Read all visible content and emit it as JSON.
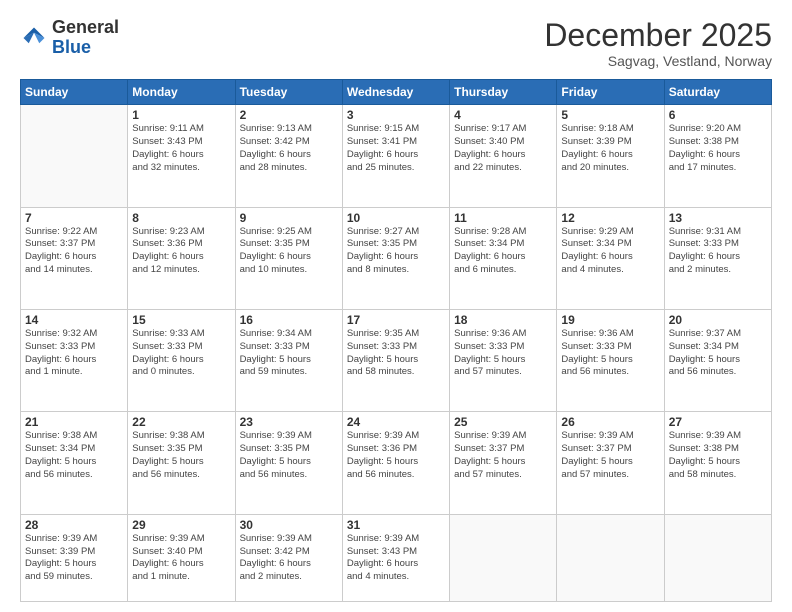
{
  "header": {
    "logo_general": "General",
    "logo_blue": "Blue",
    "month_title": "December 2025",
    "subtitle": "Sagvag, Vestland, Norway"
  },
  "calendar": {
    "days_of_week": [
      "Sunday",
      "Monday",
      "Tuesday",
      "Wednesday",
      "Thursday",
      "Friday",
      "Saturday"
    ],
    "weeks": [
      [
        {
          "day": "",
          "info": ""
        },
        {
          "day": "1",
          "info": "Sunrise: 9:11 AM\nSunset: 3:43 PM\nDaylight: 6 hours\nand 32 minutes."
        },
        {
          "day": "2",
          "info": "Sunrise: 9:13 AM\nSunset: 3:42 PM\nDaylight: 6 hours\nand 28 minutes."
        },
        {
          "day": "3",
          "info": "Sunrise: 9:15 AM\nSunset: 3:41 PM\nDaylight: 6 hours\nand 25 minutes."
        },
        {
          "day": "4",
          "info": "Sunrise: 9:17 AM\nSunset: 3:40 PM\nDaylight: 6 hours\nand 22 minutes."
        },
        {
          "day": "5",
          "info": "Sunrise: 9:18 AM\nSunset: 3:39 PM\nDaylight: 6 hours\nand 20 minutes."
        },
        {
          "day": "6",
          "info": "Sunrise: 9:20 AM\nSunset: 3:38 PM\nDaylight: 6 hours\nand 17 minutes."
        }
      ],
      [
        {
          "day": "7",
          "info": "Sunrise: 9:22 AM\nSunset: 3:37 PM\nDaylight: 6 hours\nand 14 minutes."
        },
        {
          "day": "8",
          "info": "Sunrise: 9:23 AM\nSunset: 3:36 PM\nDaylight: 6 hours\nand 12 minutes."
        },
        {
          "day": "9",
          "info": "Sunrise: 9:25 AM\nSunset: 3:35 PM\nDaylight: 6 hours\nand 10 minutes."
        },
        {
          "day": "10",
          "info": "Sunrise: 9:27 AM\nSunset: 3:35 PM\nDaylight: 6 hours\nand 8 minutes."
        },
        {
          "day": "11",
          "info": "Sunrise: 9:28 AM\nSunset: 3:34 PM\nDaylight: 6 hours\nand 6 minutes."
        },
        {
          "day": "12",
          "info": "Sunrise: 9:29 AM\nSunset: 3:34 PM\nDaylight: 6 hours\nand 4 minutes."
        },
        {
          "day": "13",
          "info": "Sunrise: 9:31 AM\nSunset: 3:33 PM\nDaylight: 6 hours\nand 2 minutes."
        }
      ],
      [
        {
          "day": "14",
          "info": "Sunrise: 9:32 AM\nSunset: 3:33 PM\nDaylight: 6 hours\nand 1 minute."
        },
        {
          "day": "15",
          "info": "Sunrise: 9:33 AM\nSunset: 3:33 PM\nDaylight: 6 hours\nand 0 minutes."
        },
        {
          "day": "16",
          "info": "Sunrise: 9:34 AM\nSunset: 3:33 PM\nDaylight: 5 hours\nand 59 minutes."
        },
        {
          "day": "17",
          "info": "Sunrise: 9:35 AM\nSunset: 3:33 PM\nDaylight: 5 hours\nand 58 minutes."
        },
        {
          "day": "18",
          "info": "Sunrise: 9:36 AM\nSunset: 3:33 PM\nDaylight: 5 hours\nand 57 minutes."
        },
        {
          "day": "19",
          "info": "Sunrise: 9:36 AM\nSunset: 3:33 PM\nDaylight: 5 hours\nand 56 minutes."
        },
        {
          "day": "20",
          "info": "Sunrise: 9:37 AM\nSunset: 3:34 PM\nDaylight: 5 hours\nand 56 minutes."
        }
      ],
      [
        {
          "day": "21",
          "info": "Sunrise: 9:38 AM\nSunset: 3:34 PM\nDaylight: 5 hours\nand 56 minutes."
        },
        {
          "day": "22",
          "info": "Sunrise: 9:38 AM\nSunset: 3:35 PM\nDaylight: 5 hours\nand 56 minutes."
        },
        {
          "day": "23",
          "info": "Sunrise: 9:39 AM\nSunset: 3:35 PM\nDaylight: 5 hours\nand 56 minutes."
        },
        {
          "day": "24",
          "info": "Sunrise: 9:39 AM\nSunset: 3:36 PM\nDaylight: 5 hours\nand 56 minutes."
        },
        {
          "day": "25",
          "info": "Sunrise: 9:39 AM\nSunset: 3:37 PM\nDaylight: 5 hours\nand 57 minutes."
        },
        {
          "day": "26",
          "info": "Sunrise: 9:39 AM\nSunset: 3:37 PM\nDaylight: 5 hours\nand 57 minutes."
        },
        {
          "day": "27",
          "info": "Sunrise: 9:39 AM\nSunset: 3:38 PM\nDaylight: 5 hours\nand 58 minutes."
        }
      ],
      [
        {
          "day": "28",
          "info": "Sunrise: 9:39 AM\nSunset: 3:39 PM\nDaylight: 5 hours\nand 59 minutes."
        },
        {
          "day": "29",
          "info": "Sunrise: 9:39 AM\nSunset: 3:40 PM\nDaylight: 6 hours\nand 1 minute."
        },
        {
          "day": "30",
          "info": "Sunrise: 9:39 AM\nSunset: 3:42 PM\nDaylight: 6 hours\nand 2 minutes."
        },
        {
          "day": "31",
          "info": "Sunrise: 9:39 AM\nSunset: 3:43 PM\nDaylight: 6 hours\nand 4 minutes."
        },
        {
          "day": "",
          "info": ""
        },
        {
          "day": "",
          "info": ""
        },
        {
          "day": "",
          "info": ""
        }
      ]
    ]
  }
}
